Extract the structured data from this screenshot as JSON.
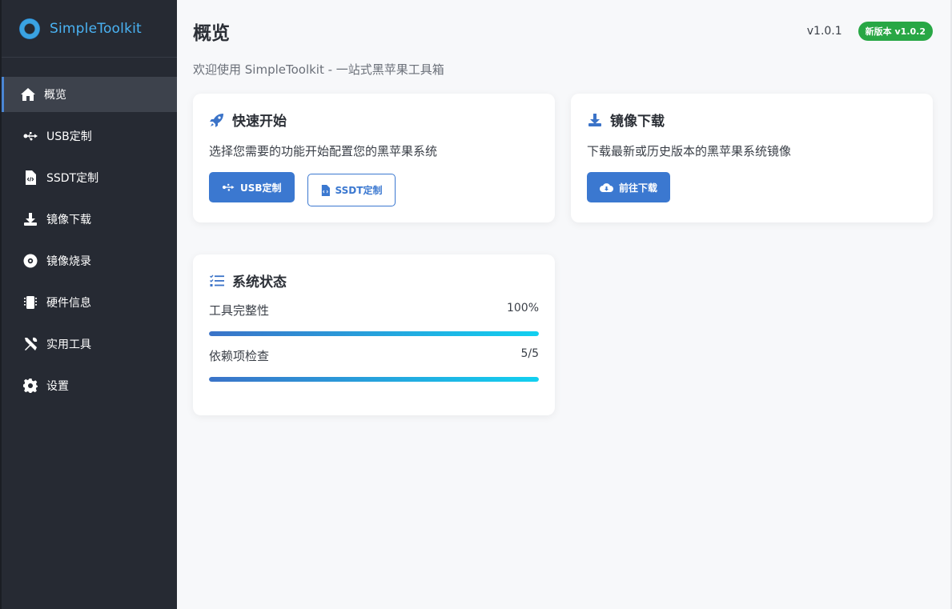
{
  "app": {
    "name": "SimpleToolkit"
  },
  "sidebar": {
    "items": [
      {
        "label": "概览",
        "icon": "home-icon",
        "active": true
      },
      {
        "label": "USB定制",
        "icon": "usb-icon",
        "active": false
      },
      {
        "label": "SSDT定制",
        "icon": "file-code-icon",
        "active": false
      },
      {
        "label": "镜像下载",
        "icon": "download-icon",
        "active": false
      },
      {
        "label": "镜像烧录",
        "icon": "disc-icon",
        "active": false
      },
      {
        "label": "硬件信息",
        "icon": "chip-icon",
        "active": false
      },
      {
        "label": "实用工具",
        "icon": "tools-icon",
        "active": false
      },
      {
        "label": "设置",
        "icon": "gear-icon",
        "active": false
      }
    ]
  },
  "header": {
    "title": "概览",
    "version": "v1.0.1",
    "update_badge": "新版本 v1.0.2",
    "subtitle": "欢迎使用 SimpleToolkit - 一站式黑苹果工具箱"
  },
  "quick_start": {
    "title": "快速开始",
    "icon": "rocket-icon",
    "text": "选择您需要的功能开始配置您的黑苹果系统",
    "usb_button": "USB定制",
    "ssdt_button": "SSDT定制"
  },
  "image_download": {
    "title": "镜像下载",
    "icon": "download-icon",
    "text": "下载最新或历史版本的黑苹果系统镜像",
    "button": "前往下载"
  },
  "system_status": {
    "title": "系统状态",
    "icon": "checklist-icon",
    "items": [
      {
        "label": "工具完整性",
        "value": "100%",
        "progress": 1.0
      },
      {
        "label": "依赖项检查",
        "value": "5/5",
        "progress": 1.0
      }
    ]
  },
  "colors": {
    "sidebar_bg": "#262a33",
    "accent": "#3b78d0",
    "badge": "#28a745",
    "brand": "#4ab3f4"
  }
}
